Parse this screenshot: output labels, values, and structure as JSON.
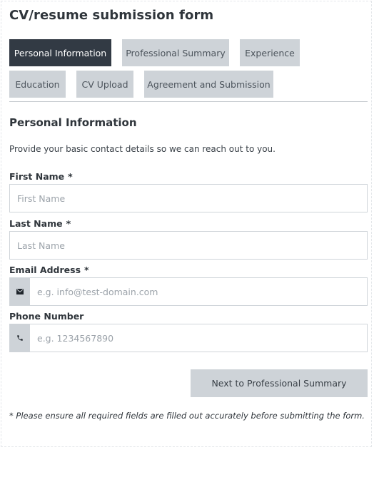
{
  "form": {
    "title": "CV/resume submission form"
  },
  "tabs": [
    {
      "label": "Personal Information",
      "active": true
    },
    {
      "label": "Professional Summary",
      "active": false
    },
    {
      "label": "Experience",
      "active": false
    },
    {
      "label": "Education",
      "active": false
    },
    {
      "label": "CV Upload",
      "active": false
    },
    {
      "label": "Agreement and Submission",
      "active": false
    }
  ],
  "section": {
    "heading": "Personal Information",
    "description": "Provide your basic contact details so we can reach out to you."
  },
  "fields": {
    "first_name": {
      "label": "First Name",
      "required_mark": "*",
      "placeholder": "First Name",
      "value": ""
    },
    "last_name": {
      "label": "Last Name",
      "required_mark": "*",
      "placeholder": "Last Name",
      "value": ""
    },
    "email": {
      "label": "Email Address",
      "required_mark": "*",
      "placeholder": "e.g. info@test-domain.com",
      "value": "",
      "icon": "envelope-icon"
    },
    "phone": {
      "label": "Phone Number",
      "placeholder": "e.g. 1234567890",
      "value": "",
      "icon": "phone-icon"
    }
  },
  "actions": {
    "next_label": "Next to Professional Summary"
  },
  "footnote": "* Please ensure all required fields are filled out accurately before submitting the form.",
  "colors": {
    "active_tab": "#323a44",
    "inactive_tab": "#ced3d8",
    "text": "#2f353b",
    "border": "#cfd4d9"
  }
}
